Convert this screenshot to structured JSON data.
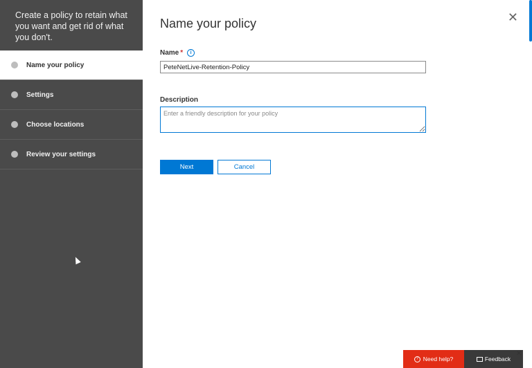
{
  "sidebar": {
    "intro": "Create a policy to retain what you want and get rid of what you don't.",
    "steps": [
      {
        "label": "Name your policy"
      },
      {
        "label": "Settings"
      },
      {
        "label": "Choose locations"
      },
      {
        "label": "Review your settings"
      }
    ]
  },
  "main": {
    "title": "Name your policy",
    "close_icon": "✕",
    "name_label": "Name",
    "required_mark": "*",
    "info_icon": "i",
    "name_value": "PeteNetLive-Retention-Policy",
    "description_label": "Description",
    "description_placeholder": "Enter a friendly description for your policy",
    "next_label": "Next",
    "cancel_label": "Cancel"
  },
  "footer": {
    "help_label": "Need help?",
    "help_icon": "?",
    "feedback_label": "Feedback",
    "close_icon": "✕"
  },
  "colors": {
    "accent": "#0078d4",
    "sidebar_bg": "#4a4a4a",
    "help_bg": "#e22d16"
  }
}
